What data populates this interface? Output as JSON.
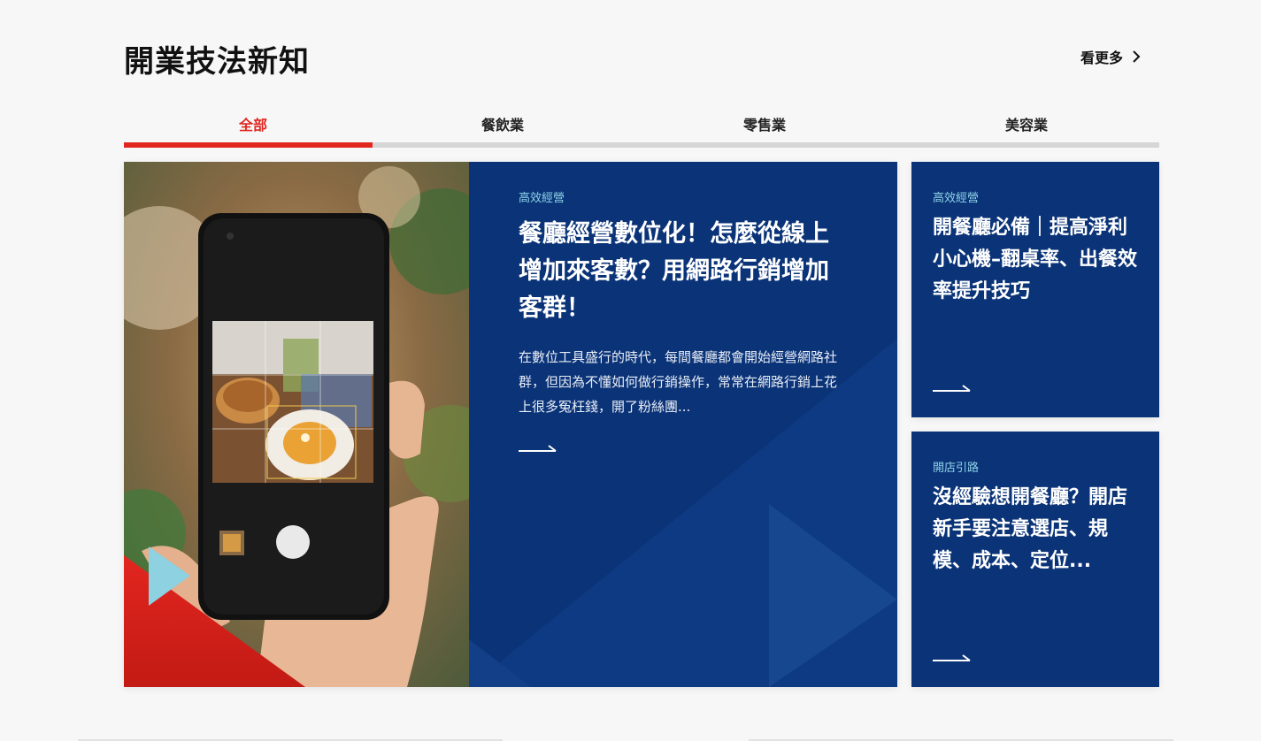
{
  "section": {
    "title": "開業技法新知",
    "see_more": "看更多"
  },
  "tabs": [
    {
      "label": "全部",
      "active": true
    },
    {
      "label": "餐飲業",
      "active": false
    },
    {
      "label": "零售業",
      "active": false
    },
    {
      "label": "美容業",
      "active": false
    }
  ],
  "featured": {
    "tag": "高效經營",
    "title": "餐廳經營數位化！怎麼從線上增加來客數？用網路行銷增加客群！",
    "excerpt": "在數位工具盛行的時代，每間餐廳都會開始經營網路社群，但因為不懂如何做行銷操作，常常在網路行銷上花上很多冤枉錢，開了粉絲團..."
  },
  "cards": [
    {
      "tag": "高效經營",
      "title": "開餐廳必備｜提高淨利小心機–翻桌率、出餐效率提升技巧"
    },
    {
      "tag": "開店引路",
      "title": "沒經驗想開餐廳？開店新手要注意選店、規模、成本、定位..."
    }
  ],
  "colors": {
    "accent_red": "#e0261f",
    "card_blue": "#0b3478",
    "tag_cyan": "#8fd3e8",
    "tab_track": "#d6d6d6"
  },
  "icons": {
    "see_more": "chevron-right-icon",
    "read_more": "long-arrow-right-icon"
  }
}
